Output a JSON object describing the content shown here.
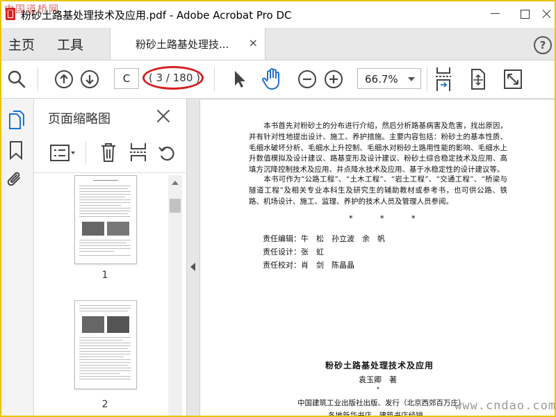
{
  "window": {
    "title": "粉砂土路基处理技术及应用.pdf - Adobe Acrobat Pro DC",
    "watermark_top": "中国道桥网",
    "watermark_bottom": "www.cndao.com"
  },
  "menu": {
    "home": "主页",
    "tools": "工具",
    "tab_label": "粉砂土路基处理技...",
    "tab_close": "×",
    "help": "?"
  },
  "toolbar": {
    "current_page": "C",
    "page_count": "( 3 / 180 )",
    "zoom": "66.7%",
    "accent_color": "#1a73c9",
    "highlight_color": "#d42020"
  },
  "thumbnails": {
    "title": "页面缩略图",
    "pages": [
      {
        "label": "1"
      },
      {
        "label": "2"
      }
    ]
  },
  "document": {
    "paragraph1": "本书首先对粉砂土的分布进行介绍，然后分析路基病害及危害，找出原因，并有针对性地提出设计、施工、养护措施。主要内容包括：粉砂土的基本性质、毛细水破坏分析、毛细水上升控制、毛细水对粉砂土路用性能的影响、毛细水上升数值模拟及设计建议、路基变形及设计建议、粉砂土综合稳定技术及应用、高填方沉降控制技术及应用、井点降水技术及应用、基于水稳定性的设计建议等。",
    "paragraph2": "本书可作为“公路工程”、“土木工程”、“岩土工程”、“交通工程”、“桥梁与隧道工程”及相关专业本科生及研究生的辅助教材或参考书，也可供公路、铁路、机场设计、施工、监理、养护的技术人员及管理人员参阅。",
    "separator": "* * *",
    "credits": [
      "责任编辑：牛　松　孙立波　余　帆",
      "责任设计：张　虹",
      "责任校对：肖　剑　陈晶晶"
    ],
    "book_title": "粉砂土路基处理技术及应用",
    "author": "袁玉卿　著",
    "small_star": "*",
    "publisher": "中国建筑工业出版社出版、发行（北京西郊百万庄）",
    "distributor": "各地新华书店、建筑书店经销"
  }
}
